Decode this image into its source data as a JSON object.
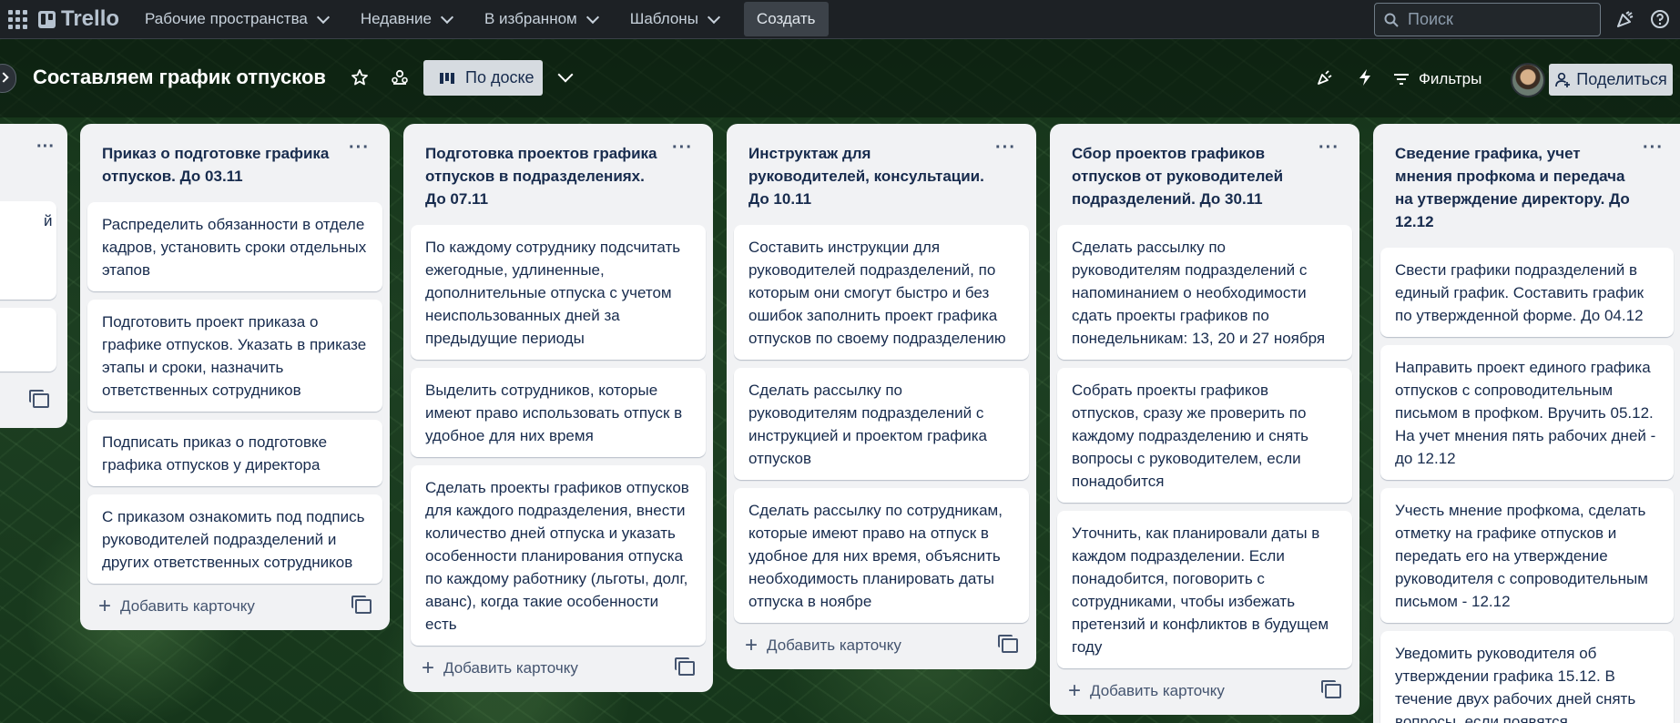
{
  "topnav": {
    "logo": "Trello",
    "menus": [
      "Рабочие пространства",
      "Недавние",
      "В избранном",
      "Шаблоны"
    ],
    "create_label": "Создать",
    "search_placeholder": "Поиск"
  },
  "board": {
    "title": "Составляем график отпусков",
    "view_label": "По доске",
    "filters_label": "Фильтры",
    "share_label": "Поделиться"
  },
  "partial_list": {
    "menu": "···",
    "fragment": "й"
  },
  "lists": [
    {
      "title": "Приказ о подготовке графика отпусков. До 03.11",
      "cards": [
        "Распределить обязанности в отделе кадров, установить сроки отдельных этапов",
        "Подготовить проект приказа о графике отпусков. Указать в приказе этапы и сроки, назначить ответственных сотрудников",
        "Подписать приказ о подготовке графика отпусков у директора",
        "С приказом ознакомить под подпись руководителей подразделений и других ответственных сотрудников"
      ],
      "add_label": "Добавить карточку"
    },
    {
      "title": "Подготовка проектов графика отпусков в подразделениях. До 07.11",
      "cards": [
        "По каждому сотруднику подсчитать ежегодные, удлиненные, дополнительные отпуска с учетом неиспользованных дней за предыдущие периоды",
        "Выделить сотрудников, которые имеют право использовать отпуск в удобное для них время",
        "Сделать проекты графиков отпусков для каждого подразделения, внести количество дней отпуска и указать особенности планирования отпуска по каждому работнику (льготы, долг, аванс), когда такие особенности есть"
      ],
      "add_label": "Добавить карточку"
    },
    {
      "title": "Инструктаж для руководителей, консультации. До 10.11",
      "cards": [
        "Составить инструкции для руководителей подразделений, по которым они смогут быстро и без ошибок заполнить проект графика отпусков по своему подразделению",
        "Сделать рассылку по руководителям подразделений с инструкцией и проектом графика отпусков",
        "Сделать рассылку по сотрудникам, которые имеют право на отпуск в удобное для них время, объяснить необходимость планировать даты отпуска в ноябре"
      ],
      "add_label": "Добавить карточку"
    },
    {
      "title": "Сбор проектов графиков отпусков от руководителей подразделений. До 30.11",
      "cards": [
        "Сделать рассылку по руководителям подразделений с напоминанием о необходимости сдать проекты графиков по понедельникам: 13, 20 и 27 ноября",
        "Собрать проекты графиков отпусков, сразу же проверить по каждому подразделению и снять вопросы с руководителем, если понадобится",
        "Уточнить, как планировали даты в каждом подразделении. Если понадобится, поговорить с сотрудниками, чтобы избежать претензий и конфликтов в будущем году"
      ],
      "add_label": "Добавить карточку"
    },
    {
      "title": "Сведение графика, учет мнения профкома и передача на утверждение директору. До 12.12",
      "cards": [
        "Свести графики подразделений в единый график. Составить график по утвержденной форме. До 04.12",
        "Направить проект единого графика отпусков с сопроводительным письмом в профком. Вручить 05.12. На учет мнения пять рабочих дней - до 12.12",
        "Учесть мнение профкома, сделать отметку на графике отпусков и передать его на утверждение руководителя с сопроводительным письмом - 12.12",
        "Уведомить руководителя об утверждении графика 15.12. В течение двух рабочих дней снять вопросы, если появятся"
      ],
      "add_label": ""
    }
  ]
}
